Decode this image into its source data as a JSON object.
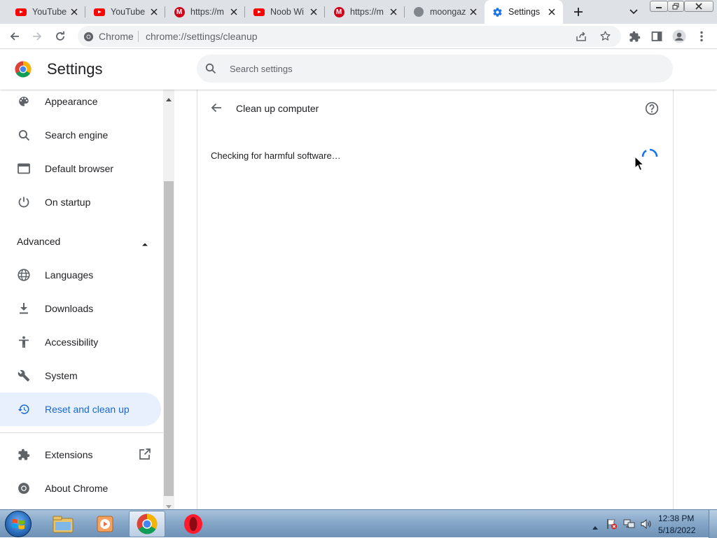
{
  "tabs": [
    {
      "title": "YouTube",
      "favicon": "youtube-icon"
    },
    {
      "title": "YouTube",
      "favicon": "youtube-icon"
    },
    {
      "title": "https://m",
      "favicon": "m-site-icon"
    },
    {
      "title": "Noob Wi",
      "favicon": "youtube-icon"
    },
    {
      "title": "https://m",
      "favicon": "m-site-icon"
    },
    {
      "title": "moongaz",
      "favicon": "globe-icon"
    },
    {
      "title": "Settings",
      "favicon": "gear-icon",
      "active": true
    }
  ],
  "omnibox": {
    "site_label": "Chrome",
    "url": "chrome://settings/cleanup"
  },
  "header": {
    "title": "Settings",
    "search_placeholder": "Search settings"
  },
  "sidebar": {
    "items": [
      {
        "label": "Appearance",
        "icon": "palette-icon"
      },
      {
        "label": "Search engine",
        "icon": "search-icon"
      },
      {
        "label": "Default browser",
        "icon": "browser-icon"
      },
      {
        "label": "On startup",
        "icon": "power-icon"
      }
    ],
    "advanced_label": "Advanced",
    "advanced_items": [
      {
        "label": "Languages",
        "icon": "globe-icon"
      },
      {
        "label": "Downloads",
        "icon": "download-icon"
      },
      {
        "label": "Accessibility",
        "icon": "accessibility-icon"
      },
      {
        "label": "System",
        "icon": "wrench-icon"
      },
      {
        "label": "Reset and clean up",
        "icon": "restore-icon",
        "selected": true
      }
    ],
    "extensions_label": "Extensions",
    "about_label": "About Chrome"
  },
  "main": {
    "page_title": "Clean up computer",
    "status": "Checking for harmful software…"
  },
  "taskbar": {
    "time": "12:38 PM",
    "date": "5/18/2022"
  },
  "colors": {
    "accent": "#1a73e8",
    "selected_bg": "#e8f0fe",
    "selected_text": "#1967d2",
    "youtube_red": "#ff0000"
  }
}
